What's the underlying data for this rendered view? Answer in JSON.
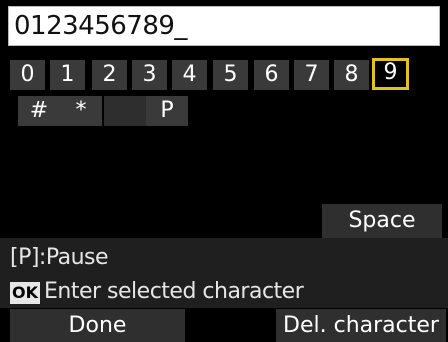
{
  "input": {
    "value": "0123456789_"
  },
  "keys_row1": [
    "0",
    "1",
    "2",
    "3",
    "4",
    "5",
    "6",
    "7",
    "8",
    "9"
  ],
  "keys_row2": [
    "#",
    "*",
    "",
    "P"
  ],
  "selected_key": "9",
  "space_label": "Space",
  "pause_hint": "[P]:Pause",
  "ok_badge": "OK",
  "ok_hint": "Enter selected character",
  "done_label": "Done",
  "delete_label": "Del. character",
  "colors": {
    "selection": "#e2c21c",
    "background": "#000000",
    "key_bg": "#3a3a3a"
  }
}
